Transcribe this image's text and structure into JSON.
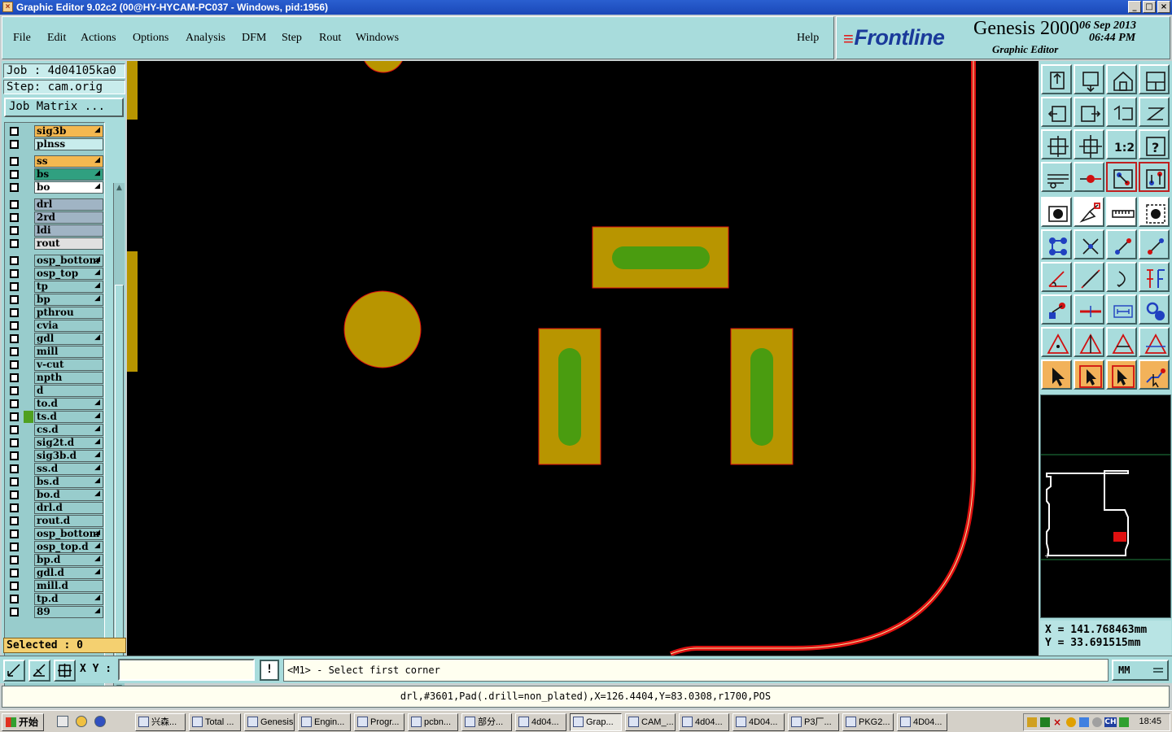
{
  "window": {
    "title": "Graphic Editor 9.02c2 (00@HY-HYCAM-PC037 - Windows, pid:1956)",
    "controls": [
      "_",
      "□",
      "×"
    ]
  },
  "menu": [
    "File",
    "Edit",
    "Actions",
    "Options",
    "Analysis",
    "DFM",
    "Step",
    "Rout",
    "Windows"
  ],
  "help_label": "Help",
  "brand": {
    "logo": "Frontline",
    "product": "Genesis 2000",
    "subtitle": "Graphic Editor",
    "date": "06 Sep 2013",
    "time": "06:44 PM"
  },
  "job": {
    "job_line": "Job : 4d04105ka0",
    "step_line": "Step: cam.orig",
    "matrix_button": "Job Matrix ..."
  },
  "layers": [
    {
      "name": "sig3b",
      "color": "#f4b850",
      "arrow": true,
      "ind": ""
    },
    {
      "name": "plnss",
      "color": "#c8ecec",
      "arrow": false,
      "ind": ""
    },
    {
      "name": "ss",
      "color": "#f4b850",
      "arrow": true,
      "ind": ""
    },
    {
      "name": "bs",
      "color": "#30a080",
      "arrow": true,
      "ind": ""
    },
    {
      "name": "bo",
      "color": "#ffffff",
      "arrow": true,
      "ind": ""
    },
    {
      "name": "drl",
      "color": "#a0b4c4",
      "arrow": false,
      "ind": ""
    },
    {
      "name": "2rd",
      "color": "#a0b4c4",
      "arrow": false,
      "ind": ""
    },
    {
      "name": "ldi",
      "color": "#a0b4c4",
      "arrow": false,
      "ind": ""
    },
    {
      "name": "rout",
      "color": "#e0e0e0",
      "arrow": false,
      "ind": ""
    },
    {
      "name": "osp_bottom",
      "color": "#98cccc",
      "arrow": true,
      "ind": ""
    },
    {
      "name": "osp_top",
      "color": "#98cccc",
      "arrow": true,
      "ind": ""
    },
    {
      "name": "tp",
      "color": "#98cccc",
      "arrow": true,
      "ind": ""
    },
    {
      "name": "bp",
      "color": "#98cccc",
      "arrow": true,
      "ind": ""
    },
    {
      "name": "pthrou",
      "color": "#98cccc",
      "arrow": false,
      "ind": ""
    },
    {
      "name": "cvia",
      "color": "#98cccc",
      "arrow": false,
      "ind": ""
    },
    {
      "name": "gdl",
      "color": "#98cccc",
      "arrow": true,
      "ind": ""
    },
    {
      "name": "mill",
      "color": "#98cccc",
      "arrow": false,
      "ind": ""
    },
    {
      "name": "v-cut",
      "color": "#98cccc",
      "arrow": false,
      "ind": ""
    },
    {
      "name": "npth",
      "color": "#98cccc",
      "arrow": false,
      "ind": ""
    },
    {
      "name": "d",
      "color": "#98cccc",
      "arrow": false,
      "ind": ""
    },
    {
      "name": "to.d",
      "color": "#98cccc",
      "arrow": true,
      "ind": ""
    },
    {
      "name": "ts.d",
      "color": "#98cccc",
      "arrow": true,
      "ind": "#50a020"
    },
    {
      "name": "cs.d",
      "color": "#98cccc",
      "arrow": true,
      "ind": ""
    },
    {
      "name": "sig2t.d",
      "color": "#98cccc",
      "arrow": true,
      "ind": ""
    },
    {
      "name": "sig3b.d",
      "color": "#98cccc",
      "arrow": true,
      "ind": ""
    },
    {
      "name": "ss.d",
      "color": "#98cccc",
      "arrow": true,
      "ind": ""
    },
    {
      "name": "bs.d",
      "color": "#98cccc",
      "arrow": true,
      "ind": ""
    },
    {
      "name": "bo.d",
      "color": "#98cccc",
      "arrow": true,
      "ind": ""
    },
    {
      "name": "drl.d",
      "color": "#98cccc",
      "arrow": false,
      "ind": ""
    },
    {
      "name": "rout.d",
      "color": "#98cccc",
      "arrow": false,
      "ind": ""
    },
    {
      "name": "osp_bottom",
      "color": "#98cccc",
      "arrow": true,
      "ind": ""
    },
    {
      "name": "osp_top.d",
      "color": "#98cccc",
      "arrow": true,
      "ind": ""
    },
    {
      "name": "bp.d",
      "color": "#98cccc",
      "arrow": true,
      "ind": ""
    },
    {
      "name": "gdl.d",
      "color": "#98cccc",
      "arrow": true,
      "ind": ""
    },
    {
      "name": "mill.d",
      "color": "#98cccc",
      "arrow": false,
      "ind": ""
    },
    {
      "name": "tp.d",
      "color": "#98cccc",
      "arrow": true,
      "ind": ""
    },
    {
      "name": "89",
      "color": "#98cccc",
      "arrow": true,
      "ind": ""
    }
  ],
  "selected_text": "Selected : 0",
  "coords": {
    "x": "X = 141.768463mm",
    "y": "Y = 33.691515mm"
  },
  "command": {
    "xy_label": "X Y :",
    "xy_value": "",
    "bang": "!",
    "prompt": "<M1> - Select first corner",
    "units": "MM"
  },
  "status_line": "drl,#3601,Pad(.drill=non_plated),X=126.4404,Y=83.0308,r1700,POS",
  "taskbar": {
    "start": "开始",
    "tasks": [
      "兴森...",
      "Total ...",
      "Genesis",
      "Engin...",
      "Progr...",
      "pcbn...",
      "部分...",
      "4d04...",
      "Grap...",
      "CAM_...",
      "4d04...",
      "4D04...",
      "P3厂...",
      "PKG2...",
      "4D04..."
    ],
    "active_task": "Grap...",
    "clock": "18:45",
    "ime": "CH"
  },
  "colors": {
    "pad": "#b89500",
    "solder_opening": "#4a9c10",
    "rout_line": "#e01010",
    "panel_bg": "#a8dcdc",
    "canvas_bg": "#000000"
  },
  "toolbox_icons": [
    "zoom-home-icon",
    "zoom-in-icon",
    "home-icon",
    "window-icon",
    "pan-left-icon",
    "pan-right-icon",
    "undo-icon",
    "redraw-icon",
    "fit-screen-icon",
    "fit-profile-icon",
    "scale-icon",
    "query-icon",
    "settings-icon",
    "snap-icon",
    "connect-icon",
    "net-icon",
    "camera-icon",
    "eraser-icon",
    "ruler-icon",
    "dot-icon",
    "node-icon",
    "intersect-icon",
    "vector-a-icon",
    "vector-b-icon",
    "angle-icon",
    "line-icon",
    "arc-icon",
    "mirror-icon",
    "point-icon",
    "dimension-icon",
    "measure-icon",
    "circles-icon",
    "triangle-a-icon",
    "triangle-b-icon",
    "triangle-c-icon",
    "triangle-d-icon",
    "pointer-icon",
    "pointer-select-icon",
    "pointer-box-icon",
    "route-icon"
  ]
}
